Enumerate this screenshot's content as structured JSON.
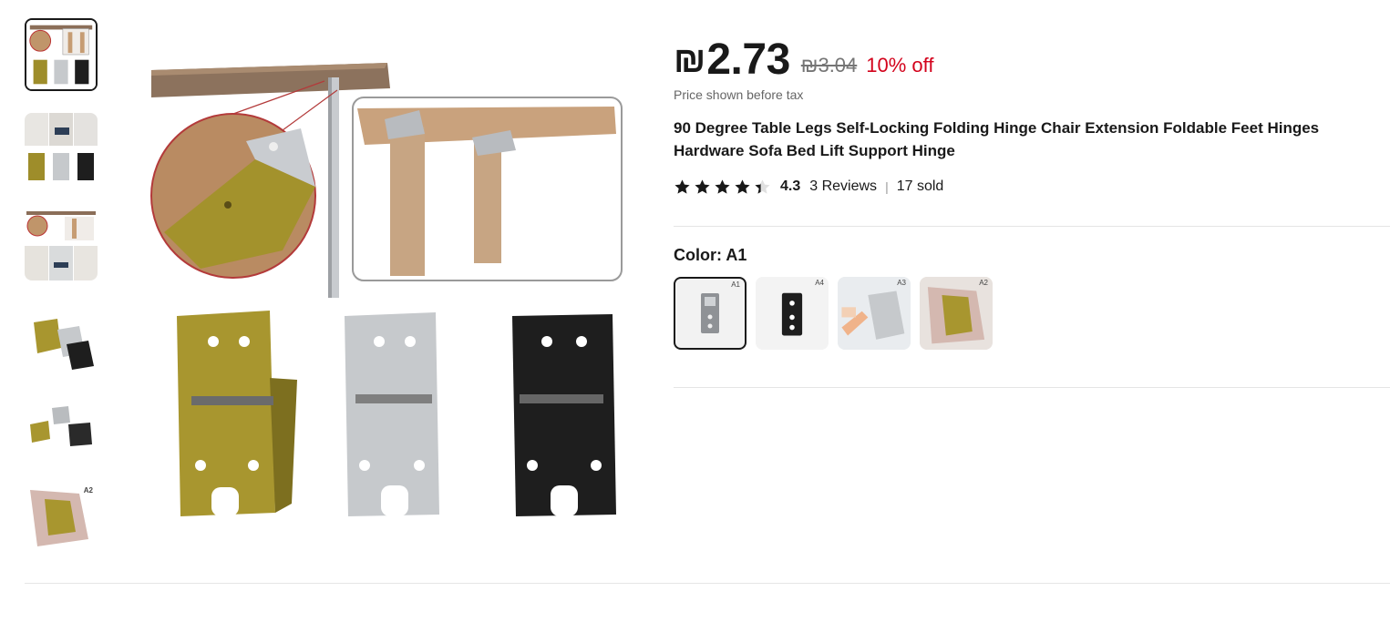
{
  "product": {
    "price_symbol": "₪",
    "price_value": "2.73",
    "original_price": "₪3.04",
    "discount": "10% off",
    "tax_note": "Price shown before tax",
    "title": "90 Degree Table Legs Self-Locking Folding Hinge Chair Extension Foldable Feet Hinges Hardware Sofa Bed Lift Support Hinge",
    "rating": "4.3",
    "rating_fraction": 0.86,
    "reviews": "3 Reviews",
    "separator": "|",
    "sold": "17 sold"
  },
  "color": {
    "label": "Color: A1",
    "options": [
      {
        "tag": "A1",
        "selected": true
      },
      {
        "tag": "A4",
        "selected": false
      },
      {
        "tag": "A3",
        "selected": false
      },
      {
        "tag": "A2",
        "selected": false
      }
    ]
  },
  "gallery": {
    "thumb_count": 6,
    "active_index": 0,
    "thumb_6_tag": "A2"
  },
  "colors": {
    "price_red": "#d3031c",
    "text": "#191919",
    "muted": "#757575",
    "brass": "#a8962f",
    "silver": "#c6c9cc",
    "black_finish": "#1e1e1e",
    "wood": "#c69c73"
  }
}
